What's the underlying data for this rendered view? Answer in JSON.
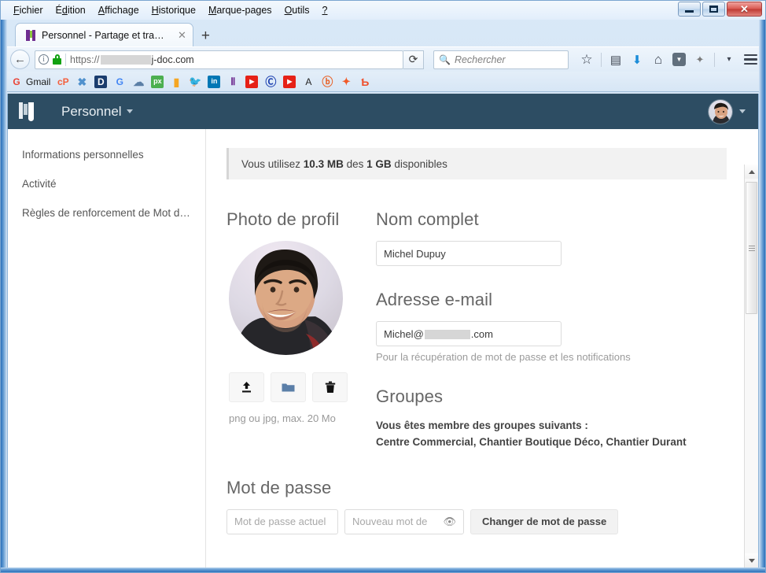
{
  "browser": {
    "menu": [
      {
        "label": "Fichier",
        "accel": "F"
      },
      {
        "label": "Édition",
        "accel": "d"
      },
      {
        "label": "Affichage",
        "accel": "A"
      },
      {
        "label": "Historique",
        "accel": "H"
      },
      {
        "label": "Marque-pages",
        "accel": "M"
      },
      {
        "label": "Outils",
        "accel": "O"
      },
      {
        "label": "?",
        "accel": "?"
      }
    ],
    "window_controls": {
      "minimize": "minimize-icon",
      "maximize": "maximize-icon",
      "close": "✕"
    },
    "tab": {
      "title": "Personnel - Partage et tran...",
      "close_label": "✕",
      "favicon": "jamespot-favicon"
    },
    "new_tab_label": "+",
    "back_label": "←",
    "url": {
      "scheme": "https://",
      "redacted": true,
      "domain": "j-doc.com",
      "identity_icon": "info-icon",
      "lock_icon": "lock-icon"
    },
    "reload_label": "⟳",
    "search": {
      "placeholder": "Rechercher",
      "icon": "search-icon"
    },
    "toolbar_icons": [
      {
        "name": "bookmark-star-icon",
        "glyph": "☆"
      },
      {
        "name": "reader-list-icon",
        "glyph": "▤"
      },
      {
        "name": "downloads-icon",
        "glyph": "⬇"
      },
      {
        "name": "home-icon",
        "glyph": "⌂"
      },
      {
        "name": "pocket-icon",
        "glyph": "▼"
      },
      {
        "name": "addon-icon",
        "glyph": "✦"
      },
      {
        "name": "overflow-chevron-icon",
        "glyph": "▾"
      },
      {
        "name": "menu-hamburger-icon",
        "glyph": "≡"
      }
    ],
    "bookmarks": [
      {
        "name": "gmail",
        "label": "Gmail",
        "glyph": "G",
        "color": "#ea4335",
        "bg": "#ffffff"
      },
      {
        "name": "copy-paste",
        "label": "",
        "glyph": "cP",
        "color": "#f4603e",
        "bg": "#ffffff"
      },
      {
        "name": "joomla",
        "label": "",
        "glyph": "✖",
        "color": "#5091cd",
        "bg": "#ffffff"
      },
      {
        "name": "dashboard",
        "label": "",
        "glyph": "D",
        "color": "#ffffff",
        "bg": "#1b3d6e"
      },
      {
        "name": "google",
        "label": "",
        "glyph": "G",
        "color": "#4285f4",
        "bg": "#ffffff"
      },
      {
        "name": "cloud",
        "label": "",
        "glyph": "☁",
        "color": "#5b7fa6",
        "bg": "#ffffff"
      },
      {
        "name": "pixabay",
        "label": "",
        "glyph": "px",
        "color": "#ffffff",
        "bg": "#4caf50"
      },
      {
        "name": "analytics",
        "label": "",
        "glyph": "▮",
        "color": "#f5a623",
        "bg": "#ffffff"
      },
      {
        "name": "twitter",
        "label": "",
        "glyph": "🐦",
        "color": "#1da1f2",
        "bg": "#ffffff"
      },
      {
        "name": "linkedin",
        "label": "",
        "glyph": "in",
        "color": "#ffffff",
        "bg": "#0077b5"
      },
      {
        "name": "jamespot",
        "label": "",
        "glyph": "Ⅱ",
        "color": "#6f2d91",
        "bg": "#ffffff"
      },
      {
        "name": "youtube",
        "label": "",
        "glyph": "▶",
        "color": "#ffffff",
        "bg": "#e62117"
      },
      {
        "name": "copyright-c",
        "label": "",
        "glyph": "C",
        "color": "#1a3fb0",
        "bg": "#ffffff"
      },
      {
        "name": "youtube-2",
        "label": "",
        "glyph": "▶",
        "color": "#ffffff",
        "bg": "#e62117"
      },
      {
        "name": "letter-a",
        "label": "A",
        "glyph": "",
        "color": "#222222",
        "bg": "transparent"
      },
      {
        "name": "b-circle",
        "label": "",
        "glyph": "ⓑ",
        "color": "#e8642a",
        "bg": "#ffffff"
      },
      {
        "name": "orange-star",
        "label": "",
        "glyph": "✦",
        "color": "#f05a28",
        "bg": "#ffffff"
      },
      {
        "name": "b-letter",
        "label": "",
        "glyph": "Ƅ",
        "color": "#ef4e2b",
        "bg": "#ffffff"
      }
    ]
  },
  "app": {
    "logo": "jamespot-logo",
    "nav_title": "Personnel",
    "nav_caret": "chevron-down-icon",
    "avatar": "user-avatar",
    "avatar_caret": "chevron-down-icon"
  },
  "sidebar": {
    "items": [
      {
        "label": "Informations personnelles",
        "active": true
      },
      {
        "label": "Activité",
        "active": false
      },
      {
        "label": "Règles de renforcement de Mot de ...",
        "active": false
      }
    ]
  },
  "main": {
    "quota": {
      "prefix": "Vous utilisez ",
      "used": "10.3 MB",
      "middle": " des ",
      "total": "1 GB",
      "suffix": " disponibles"
    },
    "photo_section": {
      "heading": "Photo de profil",
      "buttons": [
        {
          "name": "upload-button",
          "icon": "upload-icon"
        },
        {
          "name": "choose-from-files-button",
          "icon": "folder-icon"
        },
        {
          "name": "delete-photo-button",
          "icon": "trash-icon"
        }
      ],
      "hint": "png ou jpg, max. 20 Mo"
    },
    "fullname": {
      "heading": "Nom complet",
      "value": "Michel Dupuy",
      "placeholder": "Nom complet"
    },
    "email": {
      "heading": "Adresse e-mail",
      "value_prefix": "Michel@",
      "value_redacted": true,
      "value_suffix": ".com",
      "placeholder": "Adresse e-mail",
      "hint": "Pour la récupération de mot de passe et les notifications"
    },
    "groups": {
      "heading": "Groupes",
      "intro": "Vous êtes membre des groupes suivants :",
      "list": "Centre Commercial, Chantier Boutique Déco, Chantier Durant"
    },
    "password": {
      "heading": "Mot de passe",
      "current_placeholder": "Mot de passe actuel",
      "new_placeholder": "Nouveau mot de ",
      "reveal_icon": "eye-icon",
      "submit_label": "Changer de mot de passe"
    }
  },
  "colors": {
    "app_header": "#2d4d63",
    "accent_blue": "#2a6fba",
    "quota_bg": "#f2f2f2",
    "text_muted": "#999999"
  },
  "scrollbar": {
    "up_arrow": "scroll-up-icon",
    "down_arrow": "scroll-down-icon"
  }
}
